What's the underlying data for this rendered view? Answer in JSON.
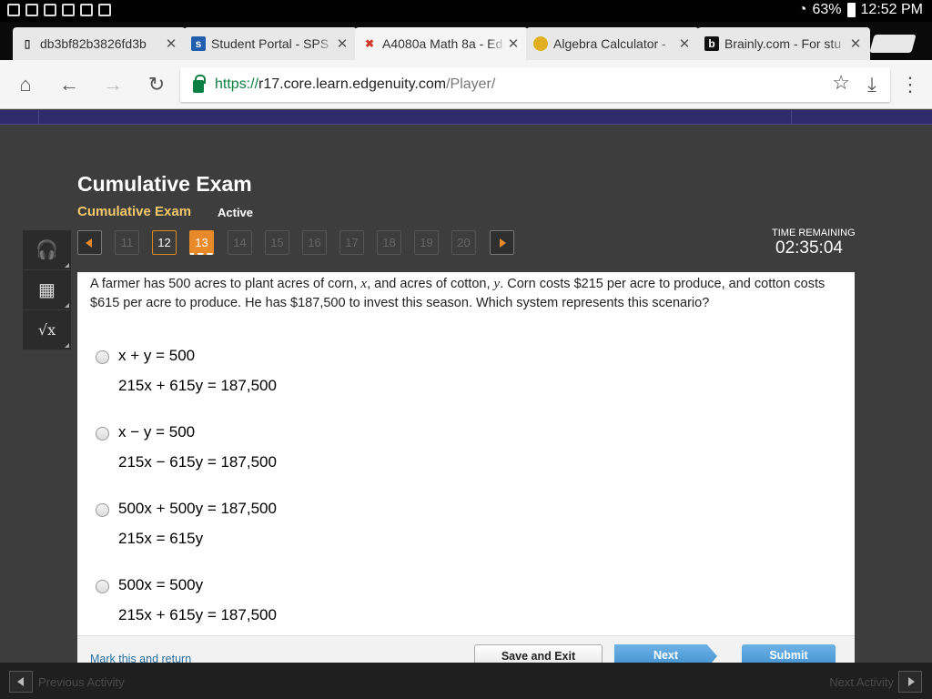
{
  "status_bar": {
    "battery": "63%",
    "time": "12:52 PM"
  },
  "browser": {
    "tabs": [
      {
        "label": "db3bf82b3826fd3b",
        "icon": "document-icon"
      },
      {
        "label": "Student Portal - SPS",
        "icon": "portal-icon"
      },
      {
        "label": "A4080a Math 8a - Ed",
        "icon": "edgenuity-icon",
        "active": true
      },
      {
        "label": "Algebra Calculator -",
        "icon": "calculator-site-icon"
      },
      {
        "label": "Brainly.com - For stu",
        "icon": "brainly-icon"
      }
    ],
    "url": {
      "scheme": "https://",
      "host": "r17.core.learn.edgenuity.com",
      "path": "/Player/"
    }
  },
  "exam": {
    "title": "Cumulative Exam",
    "subtitle": "Cumulative Exam",
    "status": "Active",
    "question_nav": [
      "11",
      "12",
      "13",
      "14",
      "15",
      "16",
      "17",
      "18",
      "19",
      "20"
    ],
    "current_question": "13",
    "timer_label": "TIME REMAINING",
    "timer_value": "02:35:04"
  },
  "question": {
    "text_parts": [
      "A farmer has 500 acres to plant acres of corn, ",
      "x",
      ", and acres of cotton, ",
      "y",
      ". Corn costs $215 per acre to produce, and cotton costs $615 per acre to produce. He has $187,500 to invest this season. Which system represents this scenario?"
    ],
    "choices": [
      {
        "line1": "x + y = 500",
        "line2": "215x + 615y = 187,500"
      },
      {
        "line1": "x − y = 500",
        "line2": "215x − 615y = 187,500"
      },
      {
        "line1": "500x + 500y = 187,500",
        "line2": "215x = 615y"
      },
      {
        "line1": "500x = 500y",
        "line2": "215x + 615y = 187,500"
      }
    ]
  },
  "footer": {
    "mark_link": "Mark this and return",
    "save_label": "Save and Exit",
    "next_label": "Next",
    "submit_label": "Submit"
  },
  "bottom_nav": {
    "prev_label": "Previous Activity",
    "next_label": "Next Activity"
  }
}
